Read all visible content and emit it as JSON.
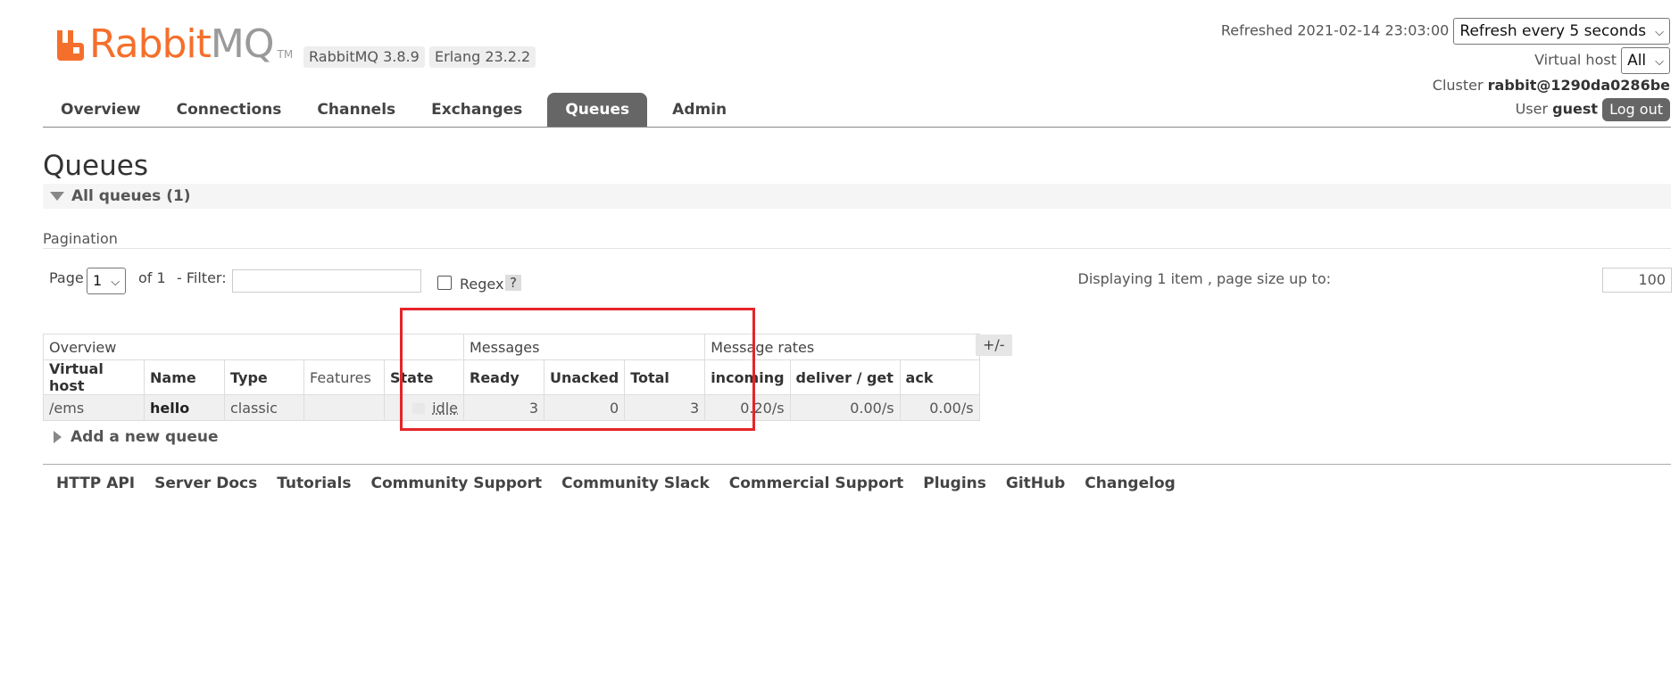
{
  "brand": {
    "rabbit": "Rabbit",
    "mq": "MQ",
    "tm": "TM",
    "version": "RabbitMQ 3.8.9",
    "erlang": "Erlang 23.2.2",
    "accent": "#f56f2c"
  },
  "nav": {
    "tabs": [
      "Overview",
      "Connections",
      "Channels",
      "Exchanges",
      "Queues",
      "Admin"
    ],
    "active": "Queues"
  },
  "topbar": {
    "refreshed": "Refreshed 2021-02-14 23:03:00",
    "refresh_select": "Refresh every 5 seconds",
    "vhost_label": "Virtual host",
    "vhost_value": "All",
    "cluster_label": "Cluster",
    "cluster_value": "rabbit@1290da0286be",
    "user_label": "User",
    "user_value": "guest",
    "logout": "Log out"
  },
  "page": {
    "title": "Queues",
    "section": "All queues (1)",
    "pagination_label": "Pagination",
    "page_label": "Page",
    "page_value": "1",
    "of_label": "of 1",
    "filter_label": "- Filter:",
    "filter_value": "",
    "regex_label": "Regex",
    "help": "?",
    "displaying": "Displaying 1 item , page size up to:",
    "page_size": "100"
  },
  "table": {
    "groups": {
      "overview": "Overview",
      "messages": "Messages",
      "rates": "Message rates"
    },
    "headers": [
      "Virtual host",
      "Name",
      "Type",
      "Features",
      "State",
      "Ready",
      "Unacked",
      "Total",
      "incoming",
      "deliver / get",
      "ack"
    ],
    "plusminus": "+/-",
    "rows": [
      {
        "vhost": "/ems",
        "name": "hello",
        "type": "classic",
        "features": "",
        "state": "idle",
        "ready": "3",
        "unacked": "0",
        "total": "3",
        "incoming": "0.20/s",
        "deliver": "0.00/s",
        "ack": "0.00/s"
      }
    ]
  },
  "add_queue": "Add a new queue",
  "footer": [
    "HTTP API",
    "Server Docs",
    "Tutorials",
    "Community Support",
    "Community Slack",
    "Commercial Support",
    "Plugins",
    "GitHub",
    "Changelog"
  ],
  "highlight_color": "#e5252a"
}
